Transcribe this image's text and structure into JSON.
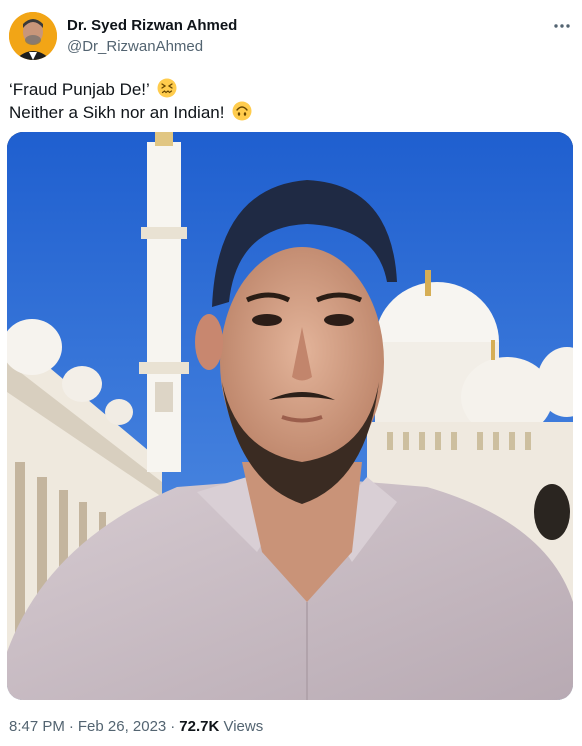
{
  "author": {
    "display_name": "Dr. Syed Rizwan Ahmed",
    "handle": "@Dr_RizwanAhmed",
    "avatar_icon": "avatar-photo"
  },
  "more_icon": "more-horizontal-icon",
  "tweet": {
    "line1": "‘Fraud Punjab De!’",
    "line1_emoji": "confounded-face-emoji",
    "line2": "Neither a Sikh nor an Indian!",
    "line2_emoji": "upside-down-face-emoji"
  },
  "media": {
    "subject": "selfie-photo",
    "colors": {
      "sky": "#2f73d8",
      "marble": "#f4f1ea",
      "shirt": "#c9bcc3"
    }
  },
  "footer": {
    "time": "8:47 PM",
    "date": "Feb 26, 2023",
    "separator": "·",
    "views_count": "72.7K",
    "views_label": "Views"
  }
}
